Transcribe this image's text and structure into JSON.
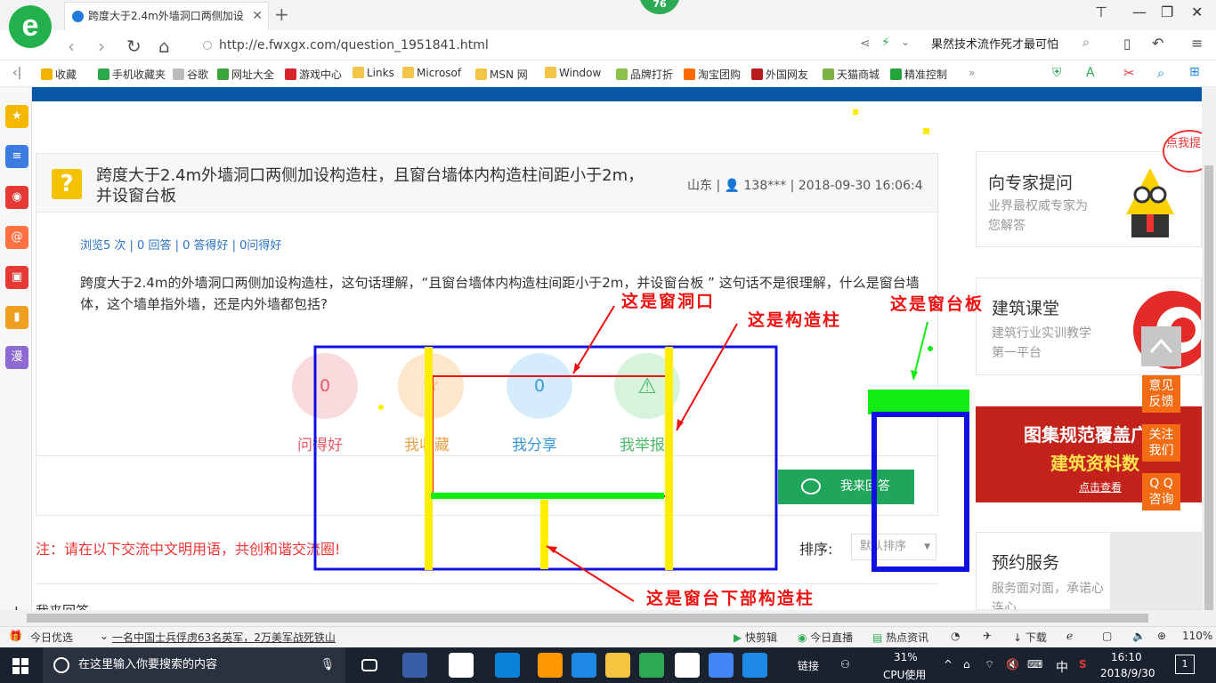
{
  "browser": {
    "tab_title": "跨度大于2.4m外墙洞口两侧加设",
    "badge": "76",
    "url": "http://e.fwxgx.com/question_1951841.html",
    "right_search": "果然技术流作死才最可怕",
    "bookmarks": [
      "收藏",
      "手机收藏夹",
      "谷歌",
      "网址大全",
      "游戏中心",
      "Links",
      "Microsof",
      "MSN 网",
      "Window",
      "品牌打折",
      "淘宝团购",
      "外国网友",
      "天猫商城",
      "精准控制"
    ],
    "bookmark_colors": [
      "#f0b400",
      "#2ca84a",
      "#bbbbbb",
      "#3aa53a",
      "#d8242a",
      "#f2c447",
      "#f2c447",
      "#f2c447",
      "#f2c447",
      "#8bc34a",
      "#ff6a00",
      "#b71c1c",
      "#7cb342",
      "#23a33a"
    ],
    "sidebar_icons": [
      "star-icon",
      "list-icon",
      "weibo-icon",
      "mail-icon",
      "game-icon",
      "note-icon",
      "comic-icon"
    ],
    "sidebar_labels": [
      "★",
      "≡",
      "◉",
      "@",
      "▣",
      "▮",
      "漫"
    ],
    "sidebar_colors": [
      "#f5b800",
      "#3c7be0",
      "#e53935",
      "#ff7043",
      "#e53935",
      "#f0a020",
      "#8e6bd1"
    ]
  },
  "question": {
    "title": "跨度大于2.4m外墙洞口两侧加设构造柱，且窗台墙体内构造柱间距小于2m，并设窗台板",
    "meta": "山东 | 👤 138*** | 2018-09-30 16:06:4",
    "stats": "浏览5 次 | 0 回答 | 0 答得好 | 0问得好",
    "body": "跨度大于2.4m的外墙洞口两侧加设构造柱，这句话理解，“且窗台墙体内构造柱间距小于2m，并设窗台板 ” 这句话不是很理解，什么是窗台墙体，这个墙单指外墙，还是内外墙都包括?",
    "actions": [
      {
        "label": "问得好",
        "count": "0"
      },
      {
        "label": "我收藏",
        "count": ""
      },
      {
        "label": "我分享",
        "count": "0"
      },
      {
        "label": "我举报",
        "count": ""
      }
    ],
    "answer_button": "我来回答",
    "notice": "注：请在以下交流中文明用语，共创和谐交流圈!",
    "sort_label": "排序:",
    "sort_value": "默认排序",
    "my_answer": "我来回答"
  },
  "right": {
    "expert_title": "向专家提问",
    "expert_sub": "业界最权威专家为您解答",
    "expert_badge": "点我提问",
    "class_title": "建筑课堂",
    "class_sub": "建筑行业实训教学第一平台",
    "banner_line1": "图集规范覆盖广",
    "banner_line2": "建筑资料数",
    "banner_link": "点击查看",
    "service_title": "预约服务",
    "service_sub": "服务面对面，承诺心连心"
  },
  "float_buttons": [
    {
      "label": "意见\n反馈"
    },
    {
      "label": "关注\n我们"
    },
    {
      "label": "Q Q\n咨询"
    }
  ],
  "annotations": {
    "window_opening": "这是窗洞口",
    "structural_column": "这是构造柱",
    "sill_board": "这是窗台板",
    "lower_column": "这是窗台下部构造柱"
  },
  "status": {
    "left1": "今日优选",
    "news": "一名中国士兵俘虏63名英军，2万美军战死铁山",
    "items": [
      "快剪辑",
      "今日直播",
      "热点资讯",
      "下载"
    ],
    "zoom": "110%"
  },
  "taskbar": {
    "search_placeholder": "在这里输入你要搜索的内容",
    "link": "链接",
    "cpu": "31%",
    "cpu_label": "CPU使用",
    "ime": "中",
    "time": "16:10",
    "date": "2018/9/30",
    "notify_count": "1",
    "app_colors": [
      "#3a5da8",
      "#ffffff",
      "#0a84d6",
      "#ff9800",
      "#1e88e5",
      "#f5c542",
      "#2eaa54",
      "#ffffff",
      "#4285f4",
      "#1e88e5"
    ]
  },
  "colors": {
    "accent_blue": "#0a57a8",
    "answer_green": "#1fa65b",
    "annotation_red": "#ee1111",
    "annotation_blue": "#1010e0",
    "annotation_yellow": "#ffee00",
    "annotation_green": "#11ee11"
  }
}
